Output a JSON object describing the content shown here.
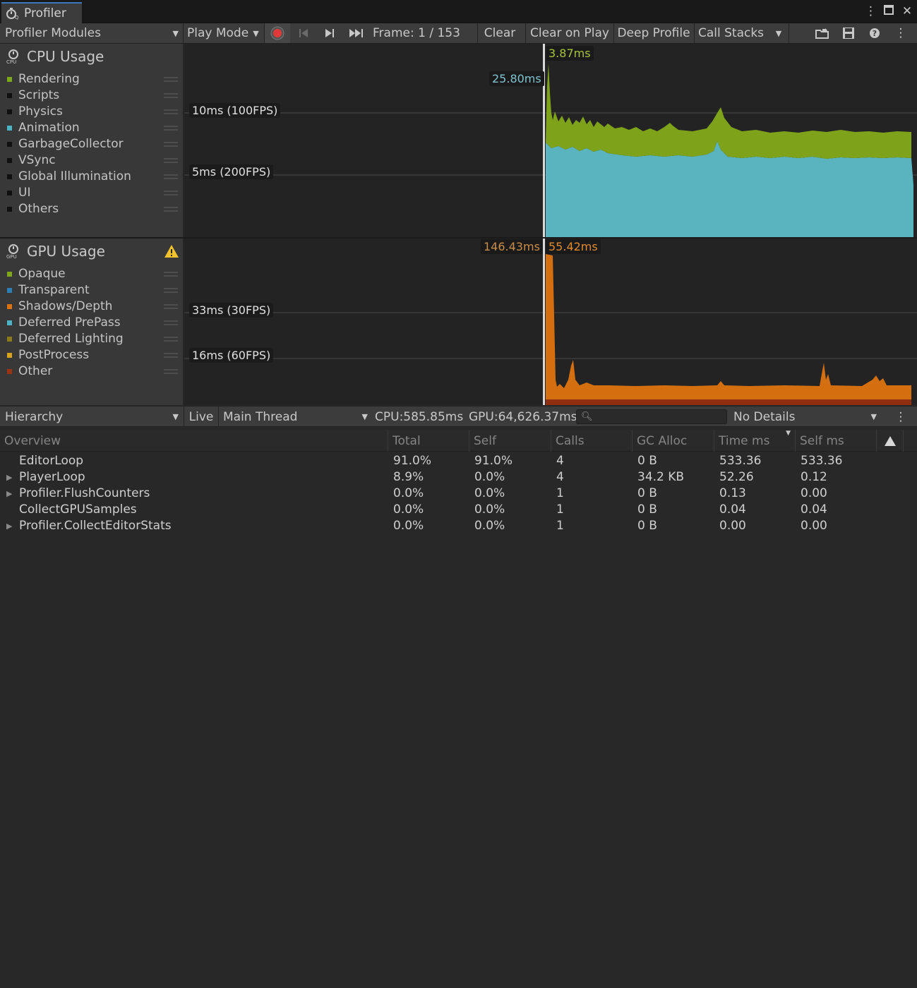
{
  "window": {
    "tab_title": "Profiler",
    "icons": {
      "profiler": "stopwatch-icon",
      "more": "vertical-ellipsis-icon",
      "maximize": "maximize-icon",
      "close": "close-icon"
    }
  },
  "toolbar": {
    "modules_dropdown": "Profiler Modules",
    "target_dropdown": "Play Mode",
    "record": "record-icon",
    "prev_frame": "previous-frame-icon",
    "next_frame": "next-frame-icon",
    "current_frame": "current-frame-icon",
    "frame_label": "Frame: 1 / 153",
    "clear": "Clear",
    "clear_on_play": "Clear on Play",
    "deep_profile": "Deep Profile",
    "call_stacks": "Call Stacks",
    "load": "load-icon",
    "save": "save-icon",
    "help": "help-icon",
    "more": "vertical-ellipsis-icon"
  },
  "cpu_module": {
    "title": "CPU Usage",
    "icon": "cpu-icon",
    "legend": [
      {
        "label": "Rendering",
        "color": "#7fa71a"
      },
      {
        "label": "Scripts",
        "color": "#101010"
      },
      {
        "label": "Physics",
        "color": "#101010"
      },
      {
        "label": "Animation",
        "color": "#4cb3c4"
      },
      {
        "label": "GarbageCollector",
        "color": "#101010"
      },
      {
        "label": "VSync",
        "color": "#101010"
      },
      {
        "label": "Global Illumination",
        "color": "#101010"
      },
      {
        "label": "UI",
        "color": "#101010"
      },
      {
        "label": "Others",
        "color": "#101010"
      }
    ],
    "grid_labels": [
      "10ms (100FPS)",
      "5ms (200FPS)"
    ],
    "selected_total": "25.80ms",
    "selected_value": "3.87ms"
  },
  "gpu_module": {
    "title": "GPU Usage",
    "icon": "gpu-icon",
    "warning": "warning-icon",
    "legend": [
      {
        "label": "Opaque",
        "color": "#7fa71a"
      },
      {
        "label": "Transparent",
        "color": "#2f7fb7"
      },
      {
        "label": "Shadows/Depth",
        "color": "#d9720f"
      },
      {
        "label": "Deferred PrePass",
        "color": "#4cb3c4"
      },
      {
        "label": "Deferred Lighting",
        "color": "#8a7a1a"
      },
      {
        "label": "PostProcess",
        "color": "#d6a31a"
      },
      {
        "label": "Other",
        "color": "#9a3412"
      }
    ],
    "grid_labels": [
      "33ms (30FPS)",
      "16ms (60FPS)"
    ],
    "selected_total": "146.43ms",
    "selected_value": "55.42ms"
  },
  "details_bar": {
    "view_dropdown": "Hierarchy",
    "live": "Live",
    "thread_dropdown": "Main Thread",
    "cpu_time": "CPU:585.85ms",
    "gpu_time": "GPU:64,626.37ms",
    "search_icon": "search-icon",
    "details_dropdown": "No Details",
    "more": "vertical-ellipsis-icon"
  },
  "table": {
    "columns": [
      "Overview",
      "Total",
      "Self",
      "Calls",
      "GC Alloc",
      "Time ms",
      "Self ms"
    ],
    "warning_column_icon": "warning-icon",
    "rows": [
      {
        "name": "EditorLoop",
        "expandable": false,
        "total": "91.0%",
        "self": "91.0%",
        "calls": "4",
        "gc": "0 B",
        "time": "533.36",
        "self_ms": "533.36"
      },
      {
        "name": "PlayerLoop",
        "expandable": true,
        "total": "8.9%",
        "self": "0.0%",
        "calls": "4",
        "gc": "34.2 KB",
        "time": "52.26",
        "self_ms": "0.12"
      },
      {
        "name": "Profiler.FlushCounters",
        "expandable": true,
        "total": "0.0%",
        "self": "0.0%",
        "calls": "1",
        "gc": "0 B",
        "time": "0.13",
        "self_ms": "0.00"
      },
      {
        "name": "CollectGPUSamples",
        "expandable": false,
        "total": "0.0%",
        "self": "0.0%",
        "calls": "1",
        "gc": "0 B",
        "time": "0.04",
        "self_ms": "0.04"
      },
      {
        "name": "Profiler.CollectEditorStats",
        "expandable": true,
        "total": "0.0%",
        "self": "0.0%",
        "calls": "1",
        "gc": "0 B",
        "time": "0.00",
        "self_ms": "0.00"
      }
    ]
  }
}
